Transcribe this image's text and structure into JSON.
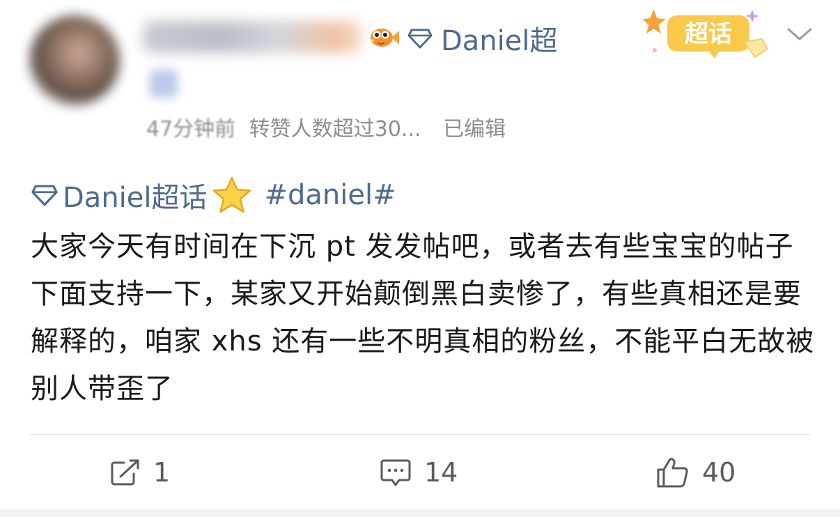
{
  "header": {
    "author_link": "Daniel超",
    "meta": {
      "time": "47分钟前",
      "likes_over": "转赞人数超过30...",
      "edited": "已编辑"
    },
    "badge_text": "超话"
  },
  "post": {
    "topic_link": "Daniel超话",
    "hashtag": "#daniel#",
    "body": "大家今天有时间在下沉 pt 发发帖吧，或者去有些宝宝的帖子下面支持一下，某家又开始颠倒黑白卖惨了，有些真相还是要解释的，咱家 xhs 还有一些不明真相的粉丝，不能平白无故被别人带歪了"
  },
  "actions": {
    "repost_count": "1",
    "comment_count": "14",
    "like_count": "40"
  },
  "colors": {
    "link": "#4f6a90",
    "text": "#1a1a1a",
    "meta": "#8d8d8d",
    "badge": "#f7b733"
  }
}
